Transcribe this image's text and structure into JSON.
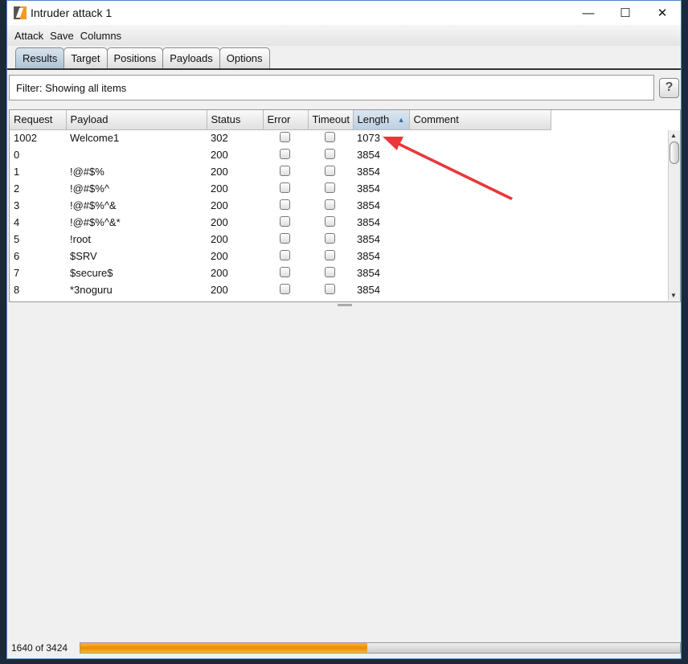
{
  "window": {
    "title": "Intruder attack 1",
    "minimize": "—",
    "maximize": "☐",
    "close": "✕"
  },
  "menu": [
    "Attack",
    "Save",
    "Columns"
  ],
  "tabs": [
    {
      "label": "Results",
      "active": true
    },
    {
      "label": "Target"
    },
    {
      "label": "Positions"
    },
    {
      "label": "Payloads"
    },
    {
      "label": "Options"
    }
  ],
  "filter": {
    "text": "Filter: Showing all items",
    "help": "?"
  },
  "table": {
    "columns": [
      "Request",
      "Payload",
      "Status",
      "Error",
      "Timeout",
      "Length",
      "Comment"
    ],
    "sorted_column": "Length",
    "sort_indicator": "▲",
    "rows": [
      {
        "request": "1002",
        "payload": "Welcome1",
        "status": "302",
        "error": false,
        "timeout": false,
        "length": "1073",
        "comment": ""
      },
      {
        "request": "0",
        "payload": "",
        "status": "200",
        "error": false,
        "timeout": false,
        "length": "3854",
        "comment": ""
      },
      {
        "request": "1",
        "payload": "!@#$%",
        "status": "200",
        "error": false,
        "timeout": false,
        "length": "3854",
        "comment": ""
      },
      {
        "request": "2",
        "payload": "!@#$%^",
        "status": "200",
        "error": false,
        "timeout": false,
        "length": "3854",
        "comment": ""
      },
      {
        "request": "3",
        "payload": "!@#$%^&",
        "status": "200",
        "error": false,
        "timeout": false,
        "length": "3854",
        "comment": ""
      },
      {
        "request": "4",
        "payload": "!@#$%^&*",
        "status": "200",
        "error": false,
        "timeout": false,
        "length": "3854",
        "comment": ""
      },
      {
        "request": "5",
        "payload": "!root",
        "status": "200",
        "error": false,
        "timeout": false,
        "length": "3854",
        "comment": ""
      },
      {
        "request": "6",
        "payload": "$SRV",
        "status": "200",
        "error": false,
        "timeout": false,
        "length": "3854",
        "comment": ""
      },
      {
        "request": "7",
        "payload": "$secure$",
        "status": "200",
        "error": false,
        "timeout": false,
        "length": "3854",
        "comment": ""
      },
      {
        "request": "8",
        "payload": "*3noguru",
        "status": "200",
        "error": false,
        "timeout": false,
        "length": "3854",
        "comment": ""
      }
    ]
  },
  "progress": {
    "label": "1640 of 3424",
    "done": 1640,
    "total": 3424,
    "color": "#ee8c00"
  },
  "annotation": {
    "color": "#e8383a"
  }
}
